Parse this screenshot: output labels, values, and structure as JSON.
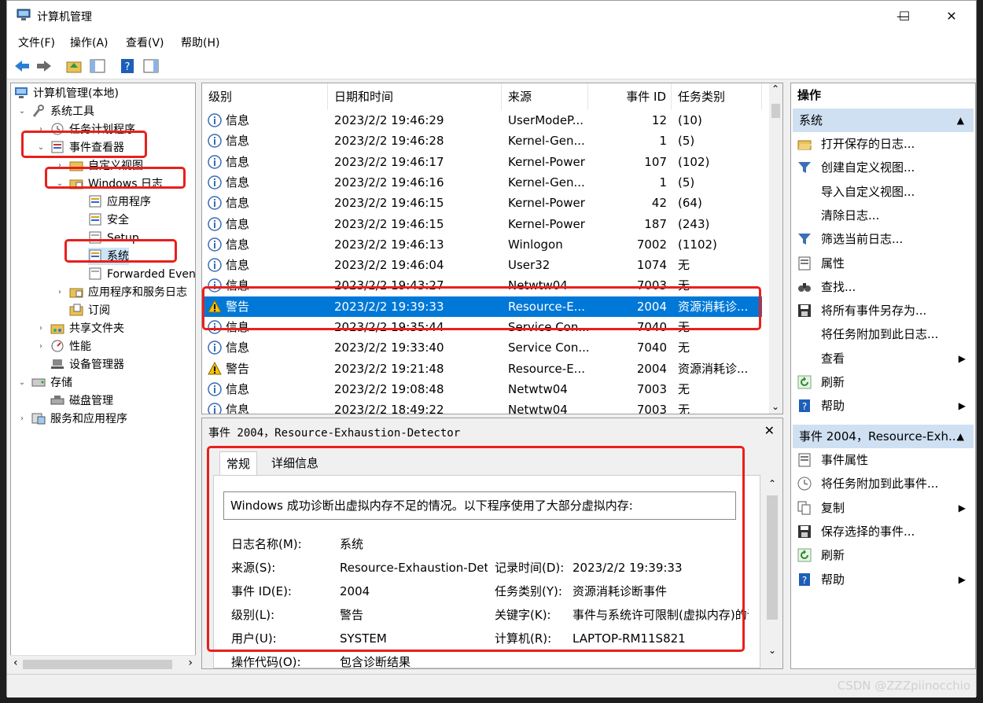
{
  "window": {
    "title": "计算机管理",
    "minimize": "—",
    "maximize": "☐",
    "close": "✕"
  },
  "menu": [
    "文件(F)",
    "操作(A)",
    "查看(V)",
    "帮助(H)"
  ],
  "tree": {
    "items": [
      {
        "label": "计算机管理(本地)",
        "expander": ""
      },
      {
        "label": "系统工具",
        "expander": "⌄"
      },
      {
        "label": "任务计划程序",
        "expander": "›"
      },
      {
        "label": "事件查看器",
        "expander": "⌄"
      },
      {
        "label": "自定义视图",
        "expander": "›"
      },
      {
        "label": "Windows 日志",
        "expander": "⌄"
      },
      {
        "label": "应用程序",
        "expander": ""
      },
      {
        "label": "安全",
        "expander": ""
      },
      {
        "label": "Setup",
        "expander": ""
      },
      {
        "label": "系统",
        "expander": ""
      },
      {
        "label": "Forwarded Even",
        "expander": ""
      },
      {
        "label": "应用程序和服务日志",
        "expander": "›"
      },
      {
        "label": "订阅",
        "expander": ""
      },
      {
        "label": "共享文件夹",
        "expander": "›"
      },
      {
        "label": "性能",
        "expander": "›"
      },
      {
        "label": "设备管理器",
        "expander": ""
      },
      {
        "label": "存储",
        "expander": "⌄"
      },
      {
        "label": "磁盘管理",
        "expander": ""
      },
      {
        "label": "服务和应用程序",
        "expander": "›"
      }
    ],
    "scroll_left": "‹",
    "scroll_right": "›"
  },
  "events": {
    "columns": [
      "级别",
      "日期和时间",
      "来源",
      "事件 ID",
      "任务类别"
    ],
    "rows": [
      {
        "level": "信息",
        "type": "info",
        "datetime": "2023/2/2 19:46:29",
        "source": "UserModeP...",
        "id": "12",
        "category": "(10)"
      },
      {
        "level": "信息",
        "type": "info",
        "datetime": "2023/2/2 19:46:28",
        "source": "Kernel-Gen...",
        "id": "1",
        "category": "(5)"
      },
      {
        "level": "信息",
        "type": "info",
        "datetime": "2023/2/2 19:46:17",
        "source": "Kernel-Power",
        "id": "107",
        "category": "(102)"
      },
      {
        "level": "信息",
        "type": "info",
        "datetime": "2023/2/2 19:46:16",
        "source": "Kernel-Gen...",
        "id": "1",
        "category": "(5)"
      },
      {
        "level": "信息",
        "type": "info",
        "datetime": "2023/2/2 19:46:15",
        "source": "Kernel-Power",
        "id": "42",
        "category": "(64)"
      },
      {
        "level": "信息",
        "type": "info",
        "datetime": "2023/2/2 19:46:15",
        "source": "Kernel-Power",
        "id": "187",
        "category": "(243)"
      },
      {
        "level": "信息",
        "type": "info",
        "datetime": "2023/2/2 19:46:13",
        "source": "Winlogon",
        "id": "7002",
        "category": "(1102)"
      },
      {
        "level": "信息",
        "type": "info",
        "datetime": "2023/2/2 19:46:04",
        "source": "User32",
        "id": "1074",
        "category": "无"
      },
      {
        "level": "信息",
        "type": "info",
        "datetime": "2023/2/2 19:43:27",
        "source": "Netwtw04",
        "id": "7003",
        "category": "无"
      },
      {
        "level": "警告",
        "type": "warn",
        "datetime": "2023/2/2 19:39:33",
        "source": "Resource-E...",
        "id": "2004",
        "category": "资源消耗诊..."
      },
      {
        "level": "信息",
        "type": "info",
        "datetime": "2023/2/2 19:35:44",
        "source": "Service Con...",
        "id": "7040",
        "category": "无"
      },
      {
        "level": "信息",
        "type": "info",
        "datetime": "2023/2/2 19:33:40",
        "source": "Service Con...",
        "id": "7040",
        "category": "无"
      },
      {
        "level": "警告",
        "type": "warn",
        "datetime": "2023/2/2 19:21:48",
        "source": "Resource-E...",
        "id": "2004",
        "category": "资源消耗诊..."
      },
      {
        "level": "信息",
        "type": "info",
        "datetime": "2023/2/2 19:08:48",
        "source": "Netwtw04",
        "id": "7003",
        "category": "无"
      },
      {
        "level": "信息",
        "type": "info",
        "datetime": "2023/2/2 18:49:22",
        "source": "Netwtw04",
        "id": "7003",
        "category": "无"
      }
    ],
    "selected_index": 9,
    "scroll_up": "⌃",
    "scroll_down": "⌄"
  },
  "detail": {
    "title": "事件 2004，Resource-Exhaustion-Detector",
    "close": "✕",
    "tabs": [
      "常规",
      "详细信息"
    ],
    "description": "Windows 成功诊断出虚拟内存不足的情况。以下程序使用了大部分虚拟内存:",
    "fields": {
      "log_name_label": "日志名称(M):",
      "log_name": "系统",
      "source_label": "来源(S):",
      "source": "Resource-Exhaustion-Detector",
      "logged_label": "记录时间(D):",
      "logged": "2023/2/2 19:39:33",
      "event_id_label": "事件 ID(E):",
      "event_id": "2004",
      "task_label": "任务类别(Y):",
      "task": "资源消耗诊断事件",
      "level_label": "级别(L):",
      "level": "警告",
      "keywords_label": "关键字(K):",
      "keywords": "事件与系统许可限制(虚拟内存)的调",
      "user_label": "用户(U):",
      "user": "SYSTEM",
      "computer_label": "计算机(R):",
      "computer": "LAPTOP-RM11S821",
      "opcode_label": "操作代码(O):",
      "opcode": "包含诊断结果"
    },
    "scroll_up": "⌃",
    "scroll_down": "⌄"
  },
  "actions": {
    "header": "操作",
    "section1": "系统",
    "section1_items": [
      {
        "label": "打开保存的日志...",
        "icon": "folder-open-icon",
        "arrow": ""
      },
      {
        "label": "创建自定义视图...",
        "icon": "filter-icon",
        "arrow": ""
      },
      {
        "label": "导入自定义视图...",
        "icon": "",
        "arrow": ""
      },
      {
        "label": "清除日志...",
        "icon": "",
        "arrow": ""
      },
      {
        "label": "筛选当前日志...",
        "icon": "filter-icon",
        "arrow": ""
      },
      {
        "label": "属性",
        "icon": "properties-icon",
        "arrow": ""
      },
      {
        "label": "查找...",
        "icon": "binoculars-icon",
        "arrow": ""
      },
      {
        "label": "将所有事件另存为...",
        "icon": "save-icon",
        "arrow": ""
      },
      {
        "label": "将任务附加到此日志...",
        "icon": "",
        "arrow": ""
      },
      {
        "label": "查看",
        "icon": "",
        "arrow": "▶"
      },
      {
        "label": "刷新",
        "icon": "refresh-icon",
        "arrow": ""
      },
      {
        "label": "帮助",
        "icon": "help-icon",
        "arrow": "▶"
      }
    ],
    "section2": "事件 2004，Resource-Exh...",
    "section2_items": [
      {
        "label": "事件属性",
        "icon": "properties-icon",
        "arrow": ""
      },
      {
        "label": "将任务附加到此事件...",
        "icon": "clock-icon",
        "arrow": ""
      },
      {
        "label": "复制",
        "icon": "copy-icon",
        "arrow": "▶"
      },
      {
        "label": "保存选择的事件...",
        "icon": "save-icon",
        "arrow": ""
      },
      {
        "label": "刷新",
        "icon": "refresh-icon",
        "arrow": ""
      },
      {
        "label": "帮助",
        "icon": "help-icon",
        "arrow": "▶"
      }
    ],
    "collapse": "▲"
  },
  "watermark": "CSDN @ZZZpiinocchio",
  "colors": {
    "selection": "#0078d7",
    "annotation": "#e8201c",
    "section": "#cfe0f3"
  }
}
